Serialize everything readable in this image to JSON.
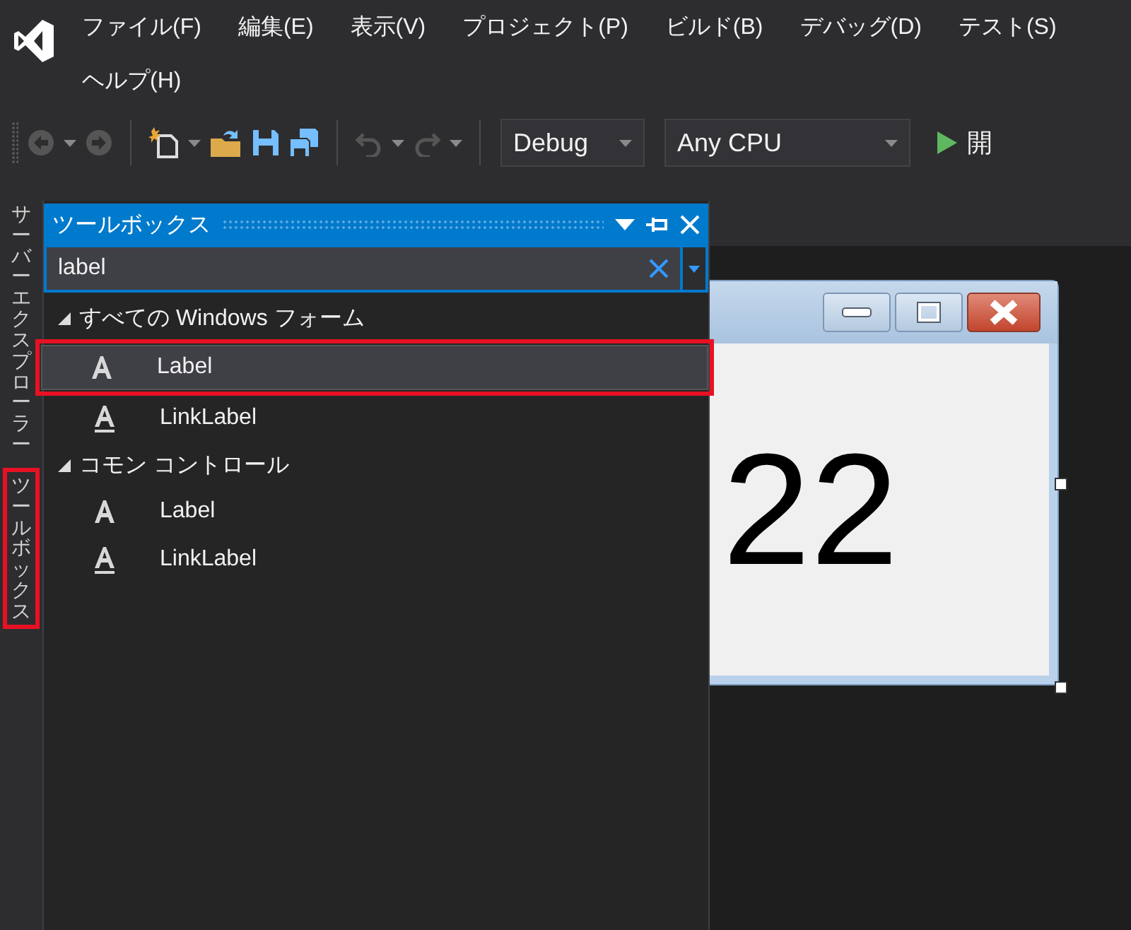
{
  "menu_rows": [
    [
      "ファイル(F)",
      "編集(E)",
      "表示(V)",
      "プロジェクト(P)",
      "ビルド(B)",
      "デバッグ(D)",
      "テスト(S)"
    ],
    [
      "ヘルプ(H)"
    ]
  ],
  "toolbar": {
    "configuration": "Debug",
    "platform": "Any CPU",
    "start_label": "開"
  },
  "side_tabs": [
    {
      "label": "サーバーエクスプローラー",
      "highlighted": false
    },
    {
      "label": "ツールボックス",
      "highlighted": true
    }
  ],
  "toolbox": {
    "title": "ツールボックス",
    "search": {
      "value": "label"
    },
    "groups": [
      {
        "label": "すべての Windows フォーム",
        "expanded": true,
        "items": [
          {
            "label": "Label",
            "kind": "label",
            "selected": true,
            "highlighted": true
          },
          {
            "label": "LinkLabel",
            "kind": "linklabel",
            "selected": false,
            "highlighted": false
          }
        ]
      },
      {
        "label": "コモン コントロール",
        "expanded": true,
        "items": [
          {
            "label": "Label",
            "kind": "label",
            "selected": false,
            "highlighted": false
          },
          {
            "label": "LinkLabel",
            "kind": "linklabel",
            "selected": false,
            "highlighted": false
          }
        ]
      }
    ]
  },
  "designer": {
    "form_text": "22"
  }
}
